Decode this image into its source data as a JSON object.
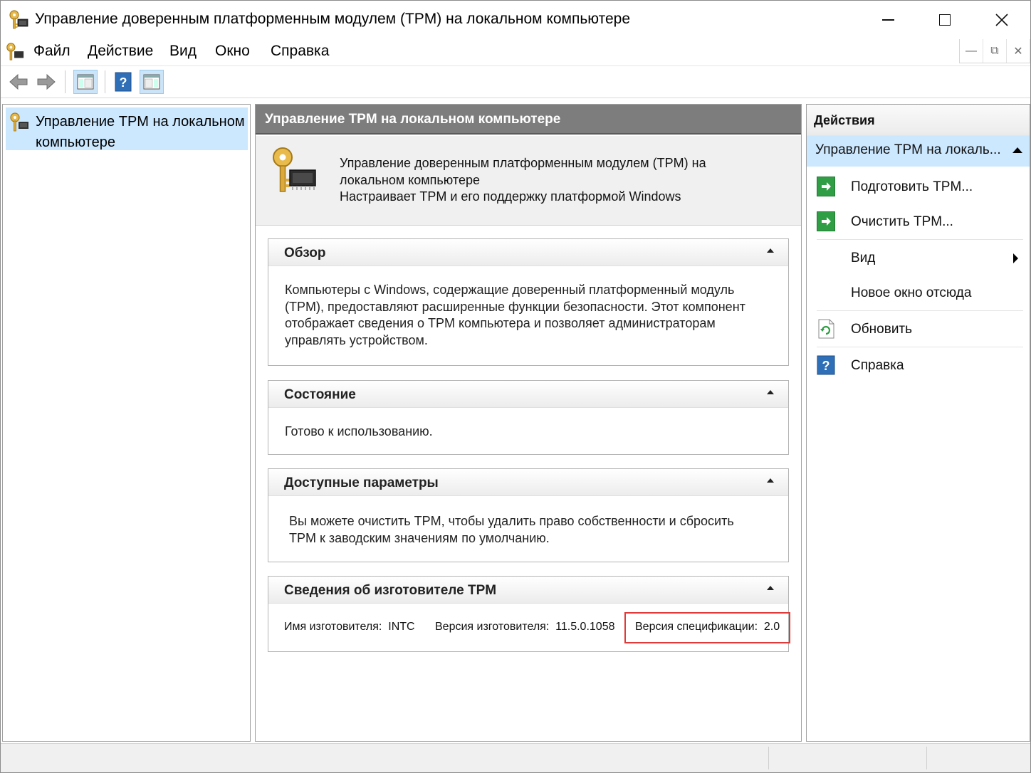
{
  "window": {
    "title": "Управление доверенным платформенным модулем (TPM) на локальном компьютере"
  },
  "menu": {
    "items": [
      "Файл",
      "Действие",
      "Вид",
      "Окно",
      "Справка"
    ]
  },
  "tree": {
    "root_label": "Управление TPM на локальном компьютере"
  },
  "center": {
    "header": "Управление TPM на локальном компьютере",
    "intro_lines": [
      "Управление доверенным платформенным модулем (TPM) на",
      "локальном компьютере",
      "Настраивает TPM и его поддержку платформой Windows"
    ],
    "overview": {
      "title": "Обзор",
      "lines": [
        "Компьютеры с Windows, содержащие доверенный платформенный модуль",
        "(TPM), предоставляют расширенные функции безопасности. Этот компонент",
        "отображает сведения о TPM компьютера и позволяет администраторам",
        "управлять устройством."
      ]
    },
    "status": {
      "title": "Состояние",
      "text": "Готово к использованию."
    },
    "options": {
      "title": "Доступные параметры",
      "lines": [
        "Вы можете очистить TPM, чтобы удалить право собственности и сбросить",
        "TPM к заводским значениям по умолчанию."
      ]
    },
    "vendor": {
      "title": "Сведения об изготовителе TPM",
      "name_label": "Имя изготовителя:",
      "name_value": "INTC",
      "version_label": "Версия изготовителя:",
      "version_value": "11.5.0.1058",
      "spec_label": "Версия спецификации:",
      "spec_value": "2.0"
    }
  },
  "actions": {
    "header": "Действия",
    "group_title": "Управление TPM на локаль...",
    "items": [
      {
        "label": "Подготовить TPM..."
      },
      {
        "label": "Очистить TPM..."
      },
      {
        "label": "Вид"
      },
      {
        "label": "Новое окно отсюда"
      },
      {
        "label": "Обновить"
      },
      {
        "label": "Справка"
      }
    ]
  },
  "colors": {
    "selection": "#cce8ff",
    "header_gray": "#7d7d7d",
    "highlight_red": "#e03a3a",
    "action_green": "#2f9e44",
    "help_blue": "#2f6fb8"
  }
}
